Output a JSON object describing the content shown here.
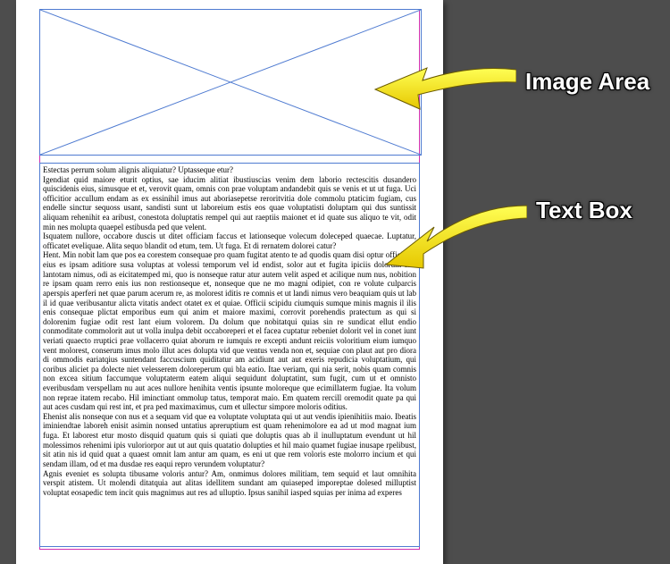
{
  "labels": {
    "image_area": "Image Area",
    "text_box": "Text Box"
  },
  "colors": {
    "canvas_bg": "#4d4d4d",
    "frame_border": "#4f7bd1",
    "guide": "#d030b0",
    "arrow": "#ffee00"
  },
  "text_frame": {
    "lead": "Estectas perrum solum alignis aliquiatur? Uptasseque etur?",
    "paragraphs": [
      "Igendiat quid maiore eturit optius, sae iducim alitiat ibustiuscias venim dem laborio rectescitis dusandero quiscidenis eius, simusque et et, verovit quam, omnis con prae voluptam andandebit quis se venis et ut ut fuga. Uci officitior accullum endam as ex essinihil imus aut aboriasepetse reroritvitia dole commolu ptaticim fugiam, cus endelle sinctur sequoss usant, sandisti sunt ut laboreium estis eos quae voluptatisti doluptam qui dus suntissit aliquam rehenihit ea aribust, conestota doluptatis rempel qui aut raeptiis maionet et id quate sus aliquo te vit, odit min nes molupta quaepel estibusda ped que velent.",
      "Isquatem nullore, occabore duscis ut ditet officiam faccus et lationseque volecum doleceped quaecae. Luptatur, officatet eveliquae. Alita sequo blandit od etum, tem. Ut fuga. Et di rernatem dolorei catur?",
      "Hent. Min nobit lam que pos ea corestem consequae pro quam fugitat atento te ad quodis quam disi optur officia sit eius es ipsam aditiore susa voluptas at volessi temporum vel id endist, solor aut et fugita ipiciis dolorum sint lantotam nimus, odi as eicitatemped mi, quo is nonseque ratur atur autem velit asped et acilique num nus, nobition re ipsam quam rerro enis ius non restionseque et, nonseque que ne mo magni odipiet, con re volute culparcis aperspis aperferi net quae parum acerum re, as molorest iditis re comnis et ut landi nimus vero beaquiam quis ut lab il id quae veribusantur alicta vitatis andect otatet ex et quiae. Officii scipidu ciumquis sumque minis magnis il ilis enis consequae plictat emporibus eum qui anim et maiore maximi, corrovit porehendis pratectum as qui si dolorenim fugiae odit rest lant eium volorem. Da dolum que nobitatqui quias sin re sundicat ellut endio conmoditate commolorit aut ut volla inulpa debit occaboreperi et el facea cuptatur rebeniet dolorit vel in conet iunt veriati quaecto rruptici prae vollacerro quiat aborum re iumquis re excepti andunt reiciis voloritium eium iumquo vent molorest, conserum imus molo illut aces dolupta vid que ventus venda non et, sequiae con plaut aut pro diora di ommodis eariatqius suntendant faccuscium quiditatur am acidiunt aut aut exeris repudicia voluptatium, qui coribus aliciet pa dolecte niet velesserem doloreperum qui bla eatio. Itae veriam, qui nia serit, nobis quam comnis non excea sitium faccumque voluptaterm eatem aliqui sequidunt doluptatint, sum fugit, cum ut et omnisto everibusdam verspellam nu aut aces nullore henihita ventis ipsunte moloreque que ecimillaterm fugiae. Ita volum non reprae itatem recabo. Hil iminctiant ommolup tatus, temporat maio. Em quatem rercill oremodit quate pa qui aut aces cusdam qui rest int, et pra ped maximaximus, cum et ullectur simpore moloris oditius.",
      "Ehenist alis nonseque con nus et a sequam vid que ea voluptate voluptata qui ut aut vendis ipienihitiis maio. Ibeatis iminiendtae laboreh enisit asimin nonsed untatius apreruptium est quam rehenimolore ea ad ut mod magnat ium fuga. Et laborest etur mosto disquid quatum quis si quiati que doluptis quas ab il inulluptatum evendunt ut hil molessimos rehenimi ipis vuloriorpor aut ut aut quis quatatio dolupties et hil maio quamet fugiae inusape rpelibust, sit atin nis id quid quat a quaest omnit lam antur am quam, es eni ut que rem voloris este molorro incium et qui sendam illam, od et ma dusdae res eaqui repro verundem voluptatur?",
      "Agnis eveniet es solupta tibusame voloris antur? Am, onmimus dolores militiam, tem sequid et laut omnihita verspit atistem. Ut molendi ditatquia aut alitas idellitem sundant am quiaseped imporeptae dolesed milluptist voluptat eosapedic tem incit quis magnimus aut res ad ulluptio. Ipsus sanihil iasped squias per inima ad experes"
    ]
  }
}
